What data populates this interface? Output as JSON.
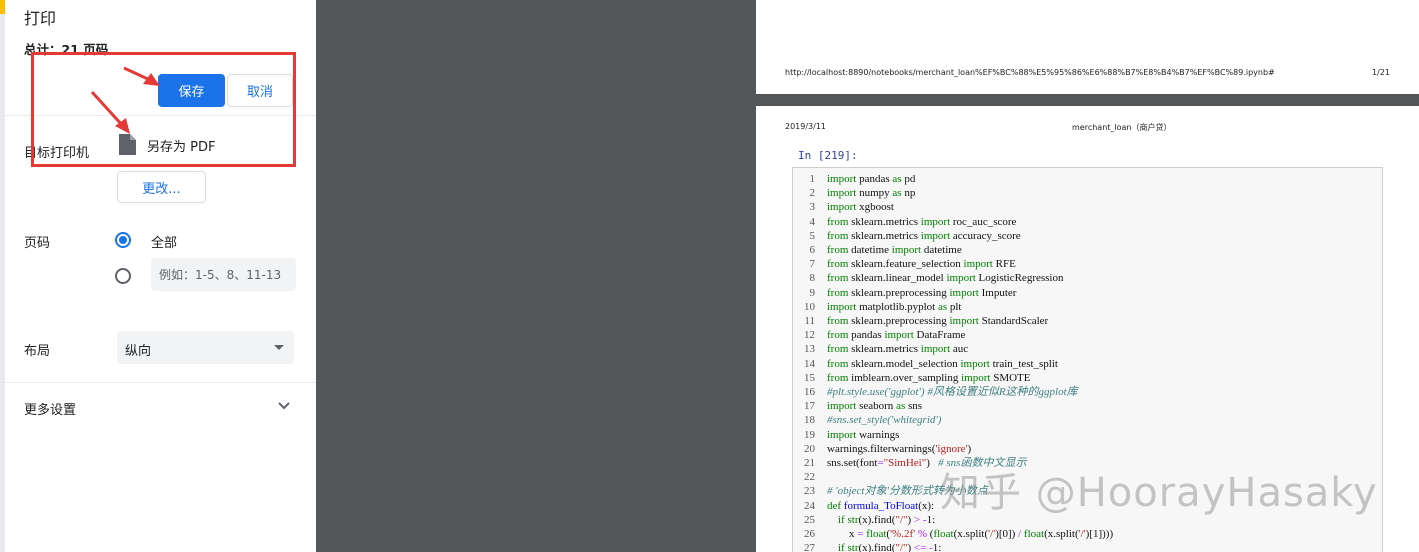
{
  "print_panel": {
    "title": "打印",
    "total_pages": "总计：21 页码",
    "save_button": "保存",
    "cancel_button": "取消",
    "destination_label": "目标打印机",
    "printer_name": "另存为 PDF",
    "change_button": "更改...",
    "pages_label": "页码",
    "pages_all_label": "全部",
    "pages_custom_placeholder": "例如：1-5、8、11-13",
    "layout_label": "布局",
    "layout_value": "纵向",
    "more_settings_label": "更多设置"
  },
  "preview": {
    "page1_url": "http://localhost:8890/notebooks/merchant_loan%EF%BC%88%E5%95%86%E6%88%B7%E8%B4%B7%EF%BC%89.ipynb#",
    "page1_number": "1/21",
    "page2_date": "2019/3/11",
    "page2_title": "merchant_loan（商户贷）",
    "cell_prompt": "In [219]:",
    "code_lines": [
      "import pandas as pd",
      "import numpy as np",
      "import xgboost",
      "from sklearn.metrics import roc_auc_score",
      "from sklearn.metrics import accuracy_score",
      "from datetime import datetime",
      "from sklearn.feature_selection import RFE",
      "from sklearn.linear_model import LogisticRegression",
      "from sklearn.preprocessing import Imputer",
      "import matplotlib.pyplot as plt",
      "from sklearn.preprocessing import StandardScaler",
      "from pandas import DataFrame",
      "from sklearn.metrics import auc",
      "from sklearn.model_selection import train_test_split",
      "from imblearn.over_sampling import SMOTE",
      "#plt.style.use('ggplot') #风格设置近似R这种的ggplot库",
      "import seaborn as sns",
      "#sns.set_style('whitegrid')",
      "import warnings",
      "warnings.filterwarnings('ignore')",
      "sns.set(font=\"SimHei\")   # sns函数中文显示",
      "",
      "# 'object对象'分数形式转为小数点",
      "def formula_ToFloat(x):",
      "    if str(x).find(\"/\") > -1:",
      "        x = float('%.2f' % (float(x.split('/')[0]) / float(x.split('/')[1])))",
      "    if str(x).find(\"/\") <= -1:"
    ]
  },
  "watermark": "知乎 @HoorayHasaky",
  "colors": {
    "accent": "#1a73e8",
    "annotation": "#e53935",
    "preview_bg": "#535659"
  }
}
